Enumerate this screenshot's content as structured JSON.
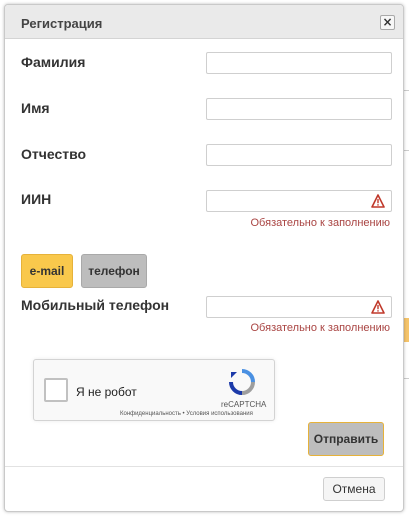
{
  "dialog": {
    "title": "Регистрация",
    "close_label": "×"
  },
  "form": {
    "surname_label": "Фамилия",
    "name_label": "Имя",
    "patronymic_label": "Отчество",
    "iin_label": "ИИН",
    "iin_error": "Обязательно к заполнению",
    "contact_toggle": {
      "email_label": "e-mail",
      "phone_label": "телефон",
      "selected": "e-mail"
    },
    "mobile_label": "Мобильный телефон",
    "mobile_error": "Обязательно к заполнению"
  },
  "captcha": {
    "checkbox_text": "Я не робот",
    "brand": "reCAPTCHA",
    "links": "Конфиденциальность • Условия использования"
  },
  "actions": {
    "submit_label": "Отправить",
    "cancel_label": "Отмена"
  },
  "colors": {
    "accent": "#f9c84c",
    "error": "#a94442",
    "warning_icon": "#c0392b"
  }
}
